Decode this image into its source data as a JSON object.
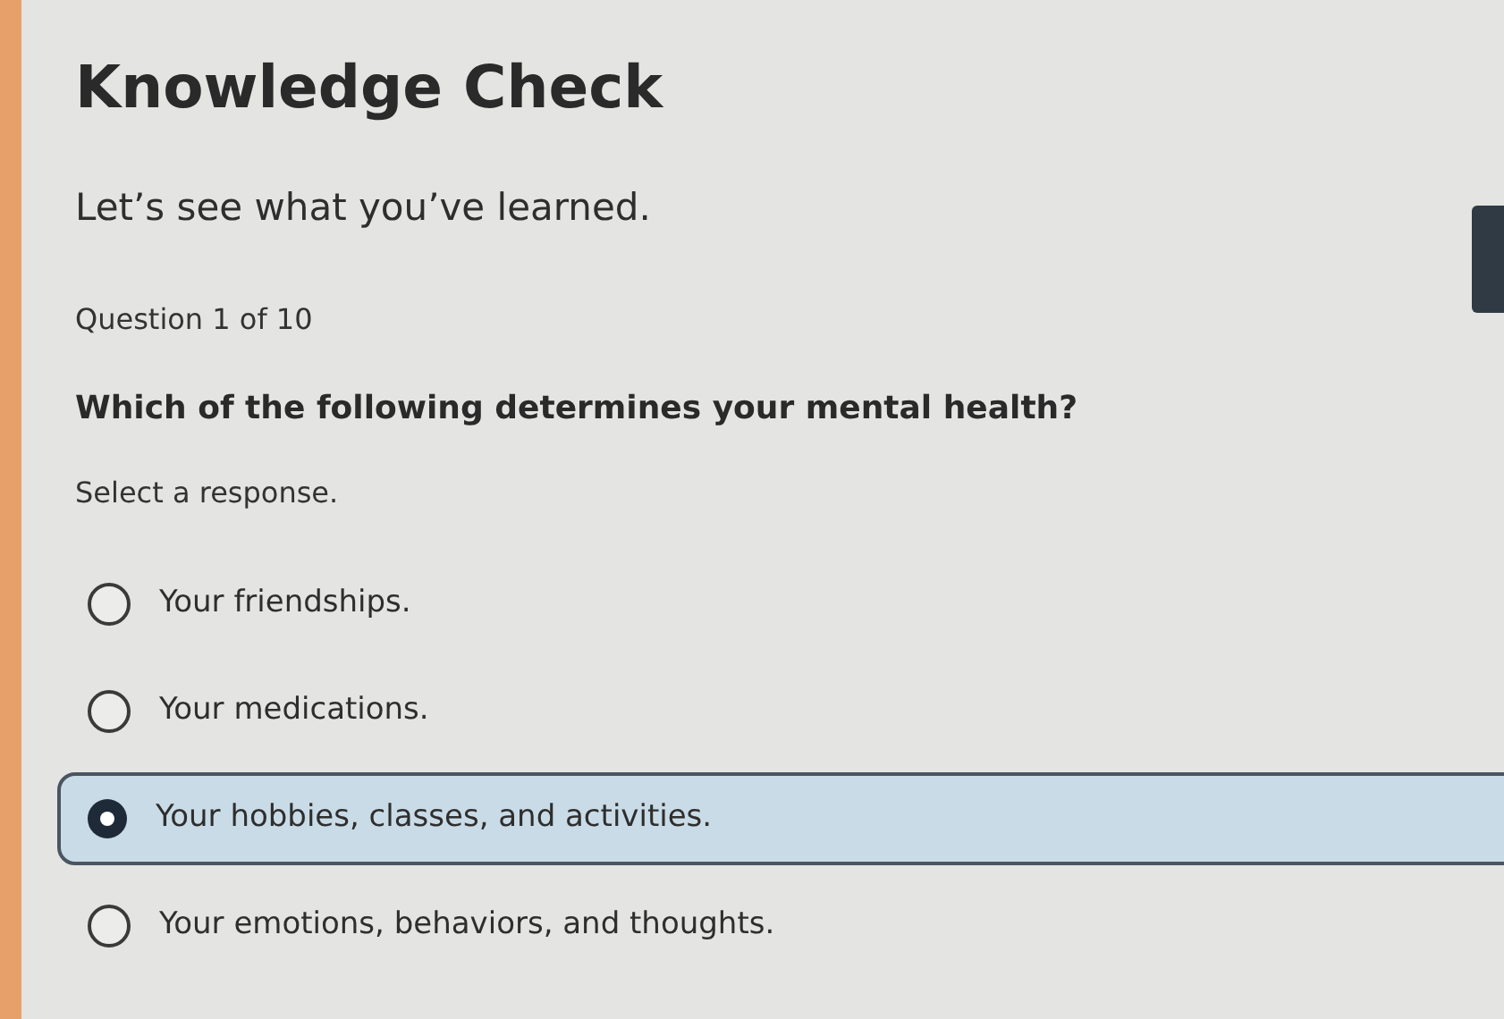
{
  "title": "Knowledge Check",
  "subtitle": "Let’s see what you’ve learned.",
  "progress": "Question 1 of 10",
  "question": "Which of the following determines your mental health?",
  "instruction": "Select a response.",
  "options": [
    {
      "label": "Your friendships.",
      "selected": false
    },
    {
      "label": "Your medications.",
      "selected": false
    },
    {
      "label": "Your hobbies, classes, and activities.",
      "selected": true
    },
    {
      "label": "Your emotions, behaviors, and thoughts.",
      "selected": false
    }
  ]
}
